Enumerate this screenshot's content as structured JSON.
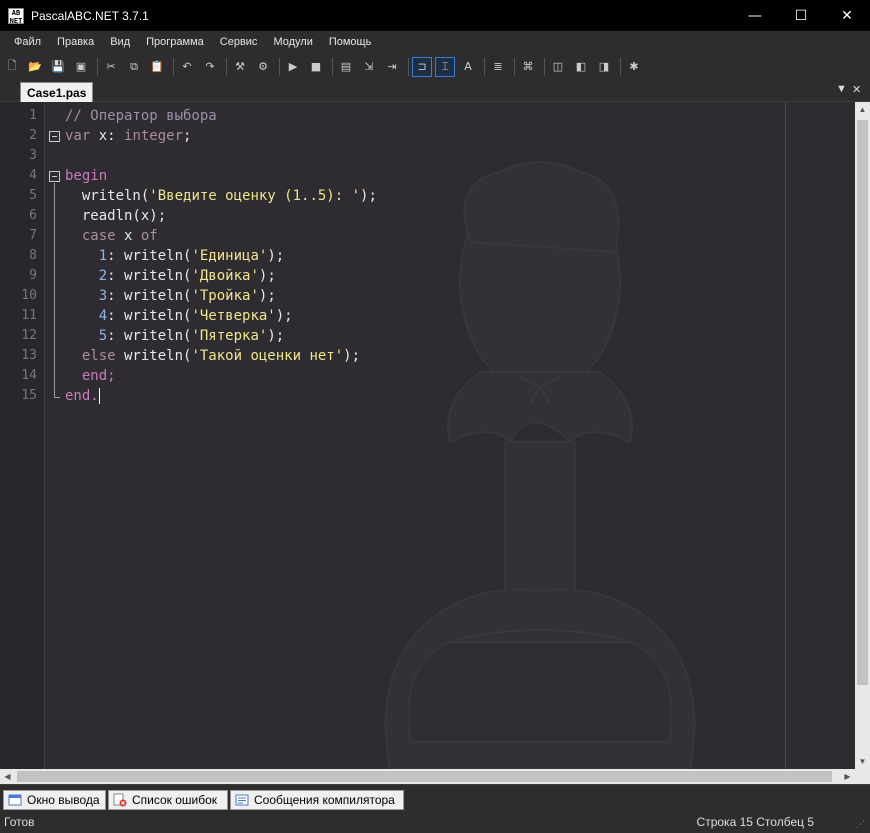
{
  "window": {
    "title": "PascalABC.NET 3.7.1",
    "icon_label": "AB NET",
    "minimize_glyph": "—",
    "maximize_glyph": "☐",
    "close_glyph": "✕"
  },
  "menu": {
    "items": [
      "Файл",
      "Правка",
      "Вид",
      "Программа",
      "Сервис",
      "Модули",
      "Помощь"
    ]
  },
  "toolbar": {
    "buttons": [
      {
        "icon": "new-file-icon",
        "glyph": "🗋"
      },
      {
        "icon": "open-file-icon",
        "glyph": "📂"
      },
      {
        "icon": "save-icon",
        "glyph": "💾"
      },
      {
        "icon": "save-all-icon",
        "glyph": "▣"
      },
      {
        "icon": "cut-icon",
        "glyph": "✂"
      },
      {
        "icon": "copy-icon",
        "glyph": "⧉"
      },
      {
        "icon": "paste-icon",
        "glyph": "📋"
      },
      {
        "icon": "undo-icon",
        "glyph": "↶"
      },
      {
        "icon": "redo-icon",
        "glyph": "↷"
      },
      {
        "icon": "compile-icon",
        "glyph": "⚒"
      },
      {
        "icon": "build-icon",
        "glyph": "⚙"
      },
      {
        "icon": "run-icon",
        "glyph": "▶"
      },
      {
        "icon": "stop-icon",
        "glyph": "■"
      },
      {
        "icon": "debug-icon",
        "glyph": "▤"
      },
      {
        "icon": "step-into-icon",
        "glyph": "⇲"
      },
      {
        "icon": "step-over-icon",
        "glyph": "⇥"
      },
      {
        "icon": "output-window-icon",
        "glyph": "⊐"
      },
      {
        "icon": "watch-window-icon",
        "glyph": "⌶"
      },
      {
        "icon": "spell-check-icon",
        "glyph": "A"
      },
      {
        "icon": "format-code-icon",
        "glyph": "≣"
      },
      {
        "icon": "code-template-icon",
        "glyph": "⌘"
      },
      {
        "icon": "form-designer-icon",
        "glyph": "◫"
      },
      {
        "icon": "tools-icon",
        "glyph": "◧"
      },
      {
        "icon": "settings-icon",
        "glyph": "◨"
      },
      {
        "icon": "plugin-icon",
        "glyph": "✱"
      }
    ]
  },
  "editor": {
    "tab_label": "Case1.pas",
    "dropdown_glyph": "▼",
    "close_glyph": "✕",
    "line_numbers": [
      "1",
      "2",
      "3",
      "4",
      "5",
      "6",
      "7",
      "8",
      "9",
      "10",
      "11",
      "12",
      "13",
      "14",
      "15"
    ],
    "lines": [
      [
        {
          "t": "// Оператор выбора",
          "c": "cm"
        }
      ],
      [
        {
          "t": "var",
          "c": "kw2"
        },
        {
          "t": " x: ",
          "c": "id"
        },
        {
          "t": "integer",
          "c": "kw2"
        },
        {
          "t": ";",
          "c": "id"
        }
      ],
      [],
      [
        {
          "t": "begin",
          "c": "kw"
        }
      ],
      [
        {
          "t": "  writeln(",
          "c": "id"
        },
        {
          "t": "'Введите оценку (1..5): '",
          "c": "str"
        },
        {
          "t": ");",
          "c": "id"
        }
      ],
      [
        {
          "t": "  readln(x);",
          "c": "id"
        }
      ],
      [
        {
          "t": "  case",
          "c": "kw2"
        },
        {
          "t": " x ",
          "c": "id"
        },
        {
          "t": "of",
          "c": "kw2"
        }
      ],
      [
        {
          "t": "    ",
          "c": "id"
        },
        {
          "t": "1",
          "c": "num"
        },
        {
          "t": ": writeln(",
          "c": "id"
        },
        {
          "t": "'Единица'",
          "c": "str"
        },
        {
          "t": ");",
          "c": "id"
        }
      ],
      [
        {
          "t": "    ",
          "c": "id"
        },
        {
          "t": "2",
          "c": "num"
        },
        {
          "t": ": writeln(",
          "c": "id"
        },
        {
          "t": "'Двойка'",
          "c": "str"
        },
        {
          "t": ");",
          "c": "id"
        }
      ],
      [
        {
          "t": "    ",
          "c": "id"
        },
        {
          "t": "3",
          "c": "num"
        },
        {
          "t": ": writeln(",
          "c": "id"
        },
        {
          "t": "'Тройка'",
          "c": "str"
        },
        {
          "t": ");",
          "c": "id"
        }
      ],
      [
        {
          "t": "    ",
          "c": "id"
        },
        {
          "t": "4",
          "c": "num"
        },
        {
          "t": ": writeln(",
          "c": "id"
        },
        {
          "t": "'Четверка'",
          "c": "str"
        },
        {
          "t": ");",
          "c": "id"
        }
      ],
      [
        {
          "t": "    ",
          "c": "id"
        },
        {
          "t": "5",
          "c": "num"
        },
        {
          "t": ": writeln(",
          "c": "id"
        },
        {
          "t": "'Пятерка'",
          "c": "str"
        },
        {
          "t": ");",
          "c": "id"
        }
      ],
      [
        {
          "t": "  else",
          "c": "kw2"
        },
        {
          "t": " writeln(",
          "c": "id"
        },
        {
          "t": "'Такой оценки нет'",
          "c": "str"
        },
        {
          "t": ");",
          "c": "id"
        }
      ],
      [
        {
          "t": "  end;",
          "c": "kw"
        }
      ],
      [
        {
          "t": "end.",
          "c": "kw"
        }
      ]
    ]
  },
  "bottom_panel": {
    "tabs": [
      {
        "label": "Окно вывода",
        "icon": "output-icon"
      },
      {
        "label": "Список ошибок",
        "icon": "error-list-icon"
      },
      {
        "label": "Сообщения компилятора",
        "icon": "compiler-messages-icon"
      }
    ]
  },
  "status": {
    "ready": "Готов",
    "position": "Строка  15  Столбец  5"
  },
  "colors": {
    "editor_bg": "#2f2c31",
    "keyword": "#c77dba",
    "string": "#f0e68c",
    "comment": "#9a8fa8",
    "number": "#8fb4e8"
  }
}
